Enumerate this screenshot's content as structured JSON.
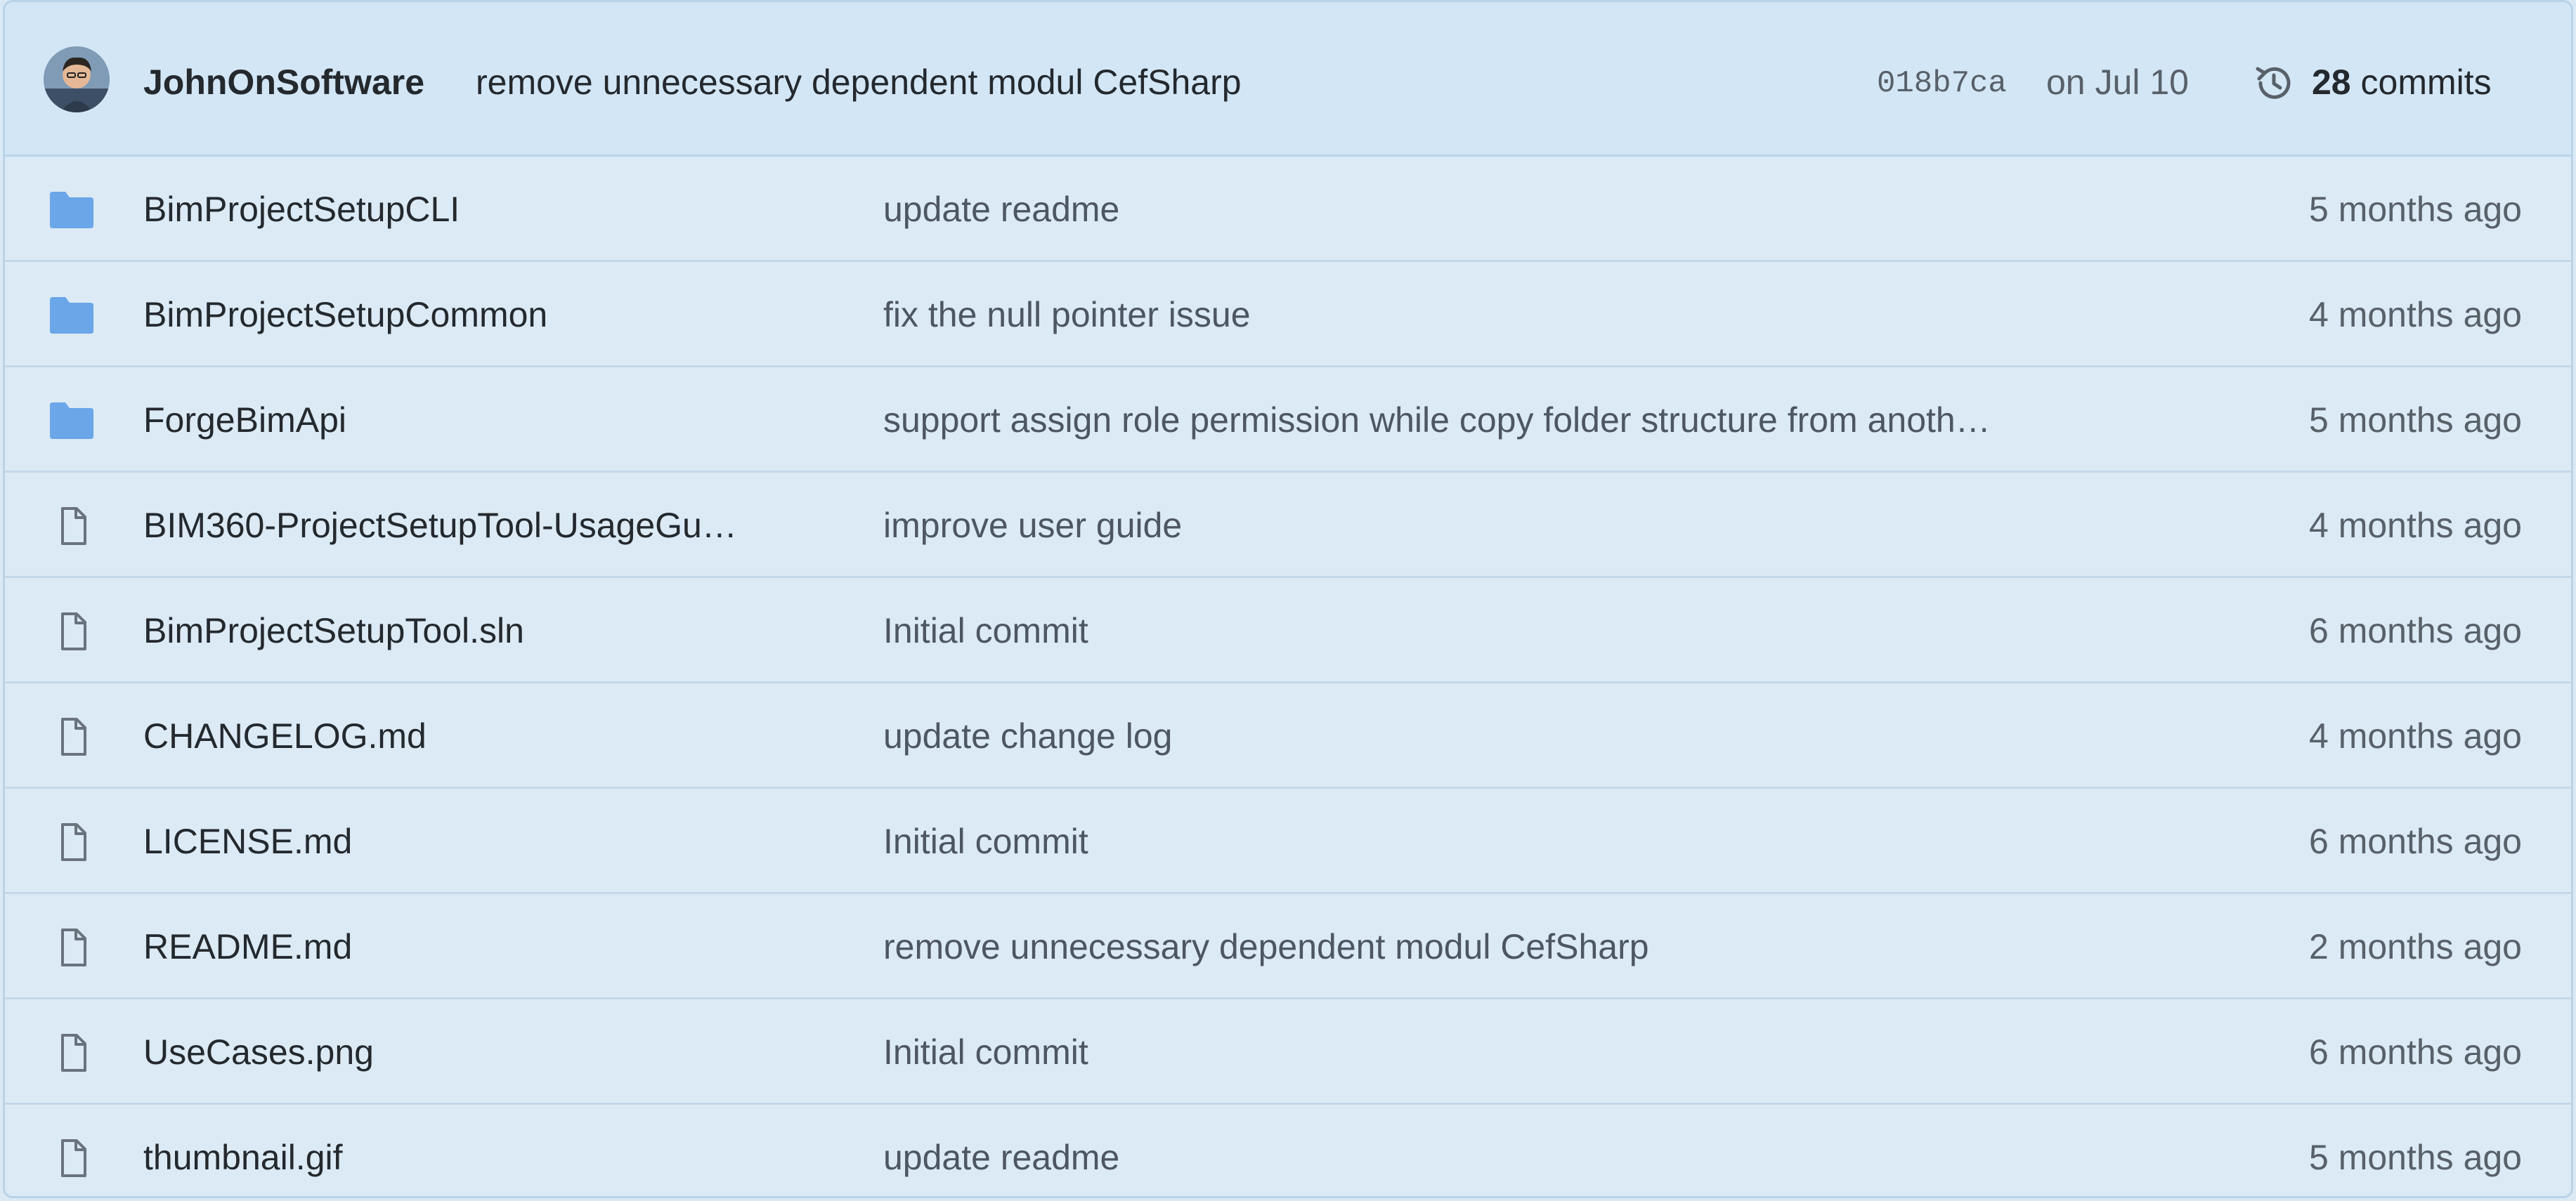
{
  "latest_commit": {
    "author": "JohnOnSoftware",
    "message": "remove unnecessary dependent modul CefSharp",
    "sha": "018b7ca",
    "date": "on Jul 10",
    "commits_count": "28",
    "commits_label": "commits",
    "history_icon": "history-icon"
  },
  "colors": {
    "folder": "#6aa6e8",
    "file_icon": "#6a737d",
    "background": "#dbeaf5"
  },
  "files": [
    {
      "type": "folder",
      "name": "BimProjectSetupCLI",
      "message": "update readme",
      "age": "5 months ago"
    },
    {
      "type": "folder",
      "name": "BimProjectSetupCommon",
      "message": "fix the null pointer issue",
      "age": "4 months ago"
    },
    {
      "type": "folder",
      "name": "ForgeBimApi",
      "message": "support assign role permission while copy folder structure from anoth…",
      "age": "5 months ago"
    },
    {
      "type": "file",
      "name": "BIM360-ProjectSetupTool-UsageGu…",
      "message": "improve user guide",
      "age": "4 months ago"
    },
    {
      "type": "file",
      "name": "BimProjectSetupTool.sln",
      "message": "Initial commit",
      "age": "6 months ago"
    },
    {
      "type": "file",
      "name": "CHANGELOG.md",
      "message": "update change log",
      "age": "4 months ago"
    },
    {
      "type": "file",
      "name": "LICENSE.md",
      "message": "Initial commit",
      "age": "6 months ago"
    },
    {
      "type": "file",
      "name": "README.md",
      "message": "remove unnecessary dependent modul CefSharp",
      "age": "2 months ago"
    },
    {
      "type": "file",
      "name": "UseCases.png",
      "message": "Initial commit",
      "age": "6 months ago"
    },
    {
      "type": "file",
      "name": "thumbnail.gif",
      "message": "update readme",
      "age": "5 months ago"
    }
  ]
}
